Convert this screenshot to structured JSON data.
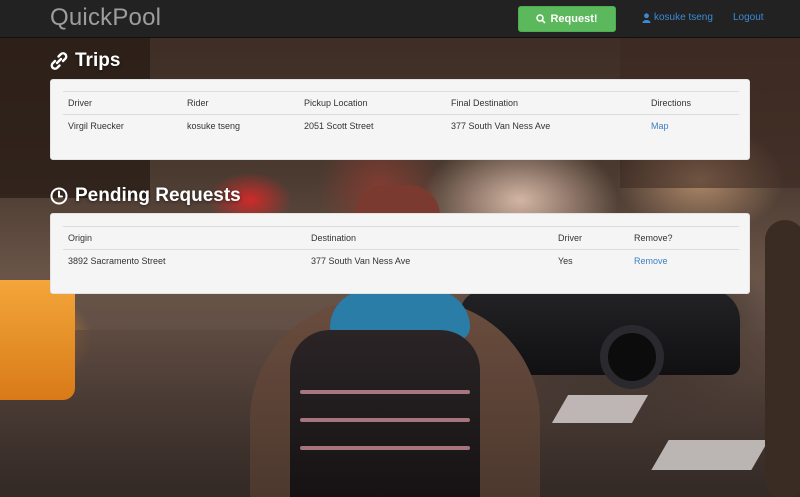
{
  "navbar": {
    "brand": "QuickPool",
    "request_label": "Request!",
    "user_name": "kosuke tseng",
    "logout_label": "Logout",
    "accent": "#5cb85c",
    "link_color": "#3b8ad8"
  },
  "trips": {
    "title": "Trips",
    "icon": "link-icon",
    "columns": [
      "Driver",
      "Rider",
      "Pickup Location",
      "Final Destination",
      "Directions"
    ],
    "rows": [
      {
        "driver": "Virgil Ruecker",
        "rider": "kosuke tseng",
        "pickup": "2051 Scott Street",
        "destination": "377 South Van Ness Ave",
        "directions": "Map"
      }
    ]
  },
  "pending": {
    "title": "Pending Requests",
    "icon": "clock-icon",
    "columns": [
      "Origin",
      "Destination",
      "Driver",
      "Remove?"
    ],
    "rows": [
      {
        "origin": "3892 Sacramento Street",
        "destination": "377 South Van Ness Ave",
        "driver": "Yes",
        "remove": "Remove"
      }
    ]
  }
}
